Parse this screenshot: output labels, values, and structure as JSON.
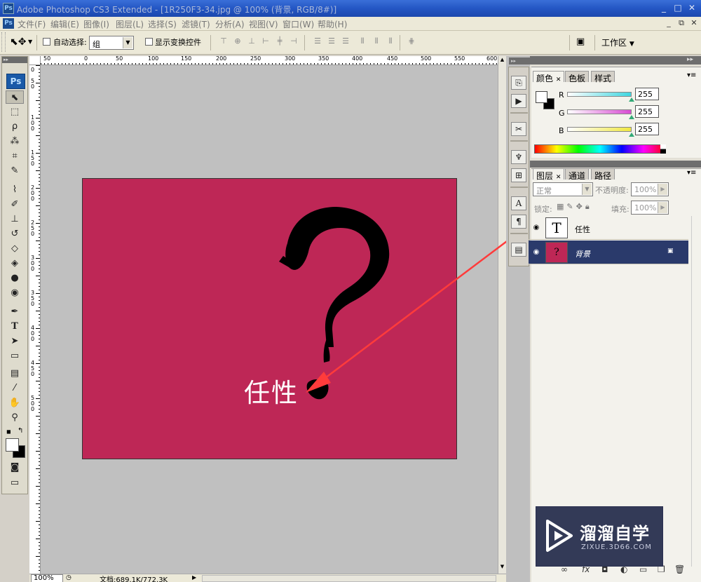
{
  "window": {
    "app_icon": "Ps",
    "title": "Adobe Photoshop CS3 Extended - [1R250F3-34.jpg @ 100% (背景, RGB/8#)]",
    "controls": [
      "_",
      "□",
      "✕"
    ]
  },
  "menu": {
    "items": [
      "文件(F)",
      "编辑(E)",
      "图像(I)",
      "图层(L)",
      "选择(S)",
      "滤镜(T)",
      "分析(A)",
      "视图(V)",
      "窗口(W)",
      "帮助(H)"
    ],
    "mdi_controls": [
      "_",
      "⧉",
      "✕"
    ]
  },
  "options_bar": {
    "auto_select_label": "自动选择:",
    "auto_select_value": "组",
    "show_transform_label": "显示变换控件",
    "workspace_label": "工作区"
  },
  "ruler": {
    "top_labels": [
      "50",
      "0",
      "50",
      "100",
      "150",
      "200",
      "250",
      "300",
      "350",
      "400",
      "450",
      "500",
      "550",
      "600"
    ],
    "left_labels": [
      "0",
      "5",
      "0",
      "1",
      "0",
      "0",
      "1",
      "5",
      "0",
      "2",
      "0",
      "0",
      "2",
      "5",
      "0",
      "3",
      "0",
      "0",
      "3",
      "5",
      "0",
      "4",
      "0",
      "0",
      "4",
      "5",
      "0",
      "5",
      "0",
      "0"
    ]
  },
  "canvas": {
    "text_layer_content": "任性",
    "background_color": "#be2756",
    "glyph_color": "#000000",
    "annotation_arrow_color": "#ff3b3b"
  },
  "status_bar": {
    "zoom": "100%",
    "doc_info": "文档:689.1K/772.3K"
  },
  "color_panel": {
    "tabs": [
      "颜色",
      "色板",
      "样式"
    ],
    "channels": [
      {
        "label": "R",
        "value": "255",
        "color": "#3fd6e0"
      },
      {
        "label": "G",
        "value": "255",
        "color": "#d84bd3"
      },
      {
        "label": "B",
        "value": "255",
        "color": "#f0e840"
      }
    ]
  },
  "layers_panel": {
    "tabs": [
      "图层",
      "通道",
      "路径"
    ],
    "blend_mode": "正常",
    "opacity_label": "不透明度:",
    "opacity_value": "100%",
    "lock_label": "锁定:",
    "fill_label": "填充:",
    "fill_value": "100%",
    "layers": [
      {
        "name": "任性",
        "type": "text",
        "thumb_glyph": "T",
        "selected": false
      },
      {
        "name": "背景",
        "type": "background",
        "thumb_glyph": "?",
        "selected": true,
        "locked": true
      }
    ],
    "bottom_icons": [
      "link-icon",
      "fx-icon",
      "mask-icon",
      "adjustment-icon",
      "group-icon",
      "new-layer-icon",
      "trash-icon"
    ]
  },
  "watermark": {
    "name": "溜溜自学",
    "url": "ZIXUE.3D66.COM"
  },
  "icons": {
    "move_tool": "move-icon",
    "dropdown": "chevron-down-icon",
    "eye": "eye-icon",
    "lock": "lock-icon"
  }
}
